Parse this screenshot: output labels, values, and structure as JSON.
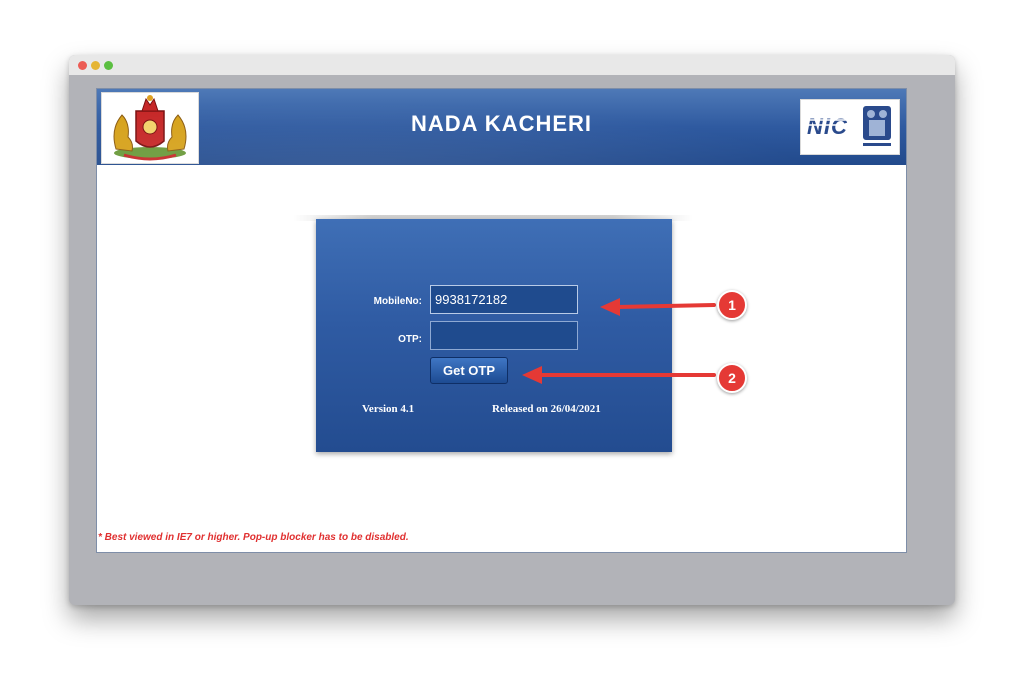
{
  "window": {
    "traffic_lights": [
      "close",
      "minimize",
      "maximize"
    ]
  },
  "banner": {
    "title": "NADA KACHERI",
    "left_emblem": "karnataka-emblem",
    "right_emblem": "nic-logo"
  },
  "login": {
    "mobile_label": "MobileNo:",
    "mobile_value": "9938172182",
    "otp_label": "OTP:",
    "otp_value": "",
    "get_otp_label": "Get OTP",
    "version": "Version 4.1",
    "released": "Released on 26/04/2021"
  },
  "note": "* Best viewed in IE7 or higher. Pop-up blocker has to be disabled.",
  "annotations": {
    "step1": "1",
    "step2": "2",
    "color": "#e53935"
  },
  "colors": {
    "banner_blue": "#2f5aa0",
    "panel_blue": "#2f5ba3",
    "note_red": "#e03030",
    "frame_gray": "#b2b3b8"
  }
}
